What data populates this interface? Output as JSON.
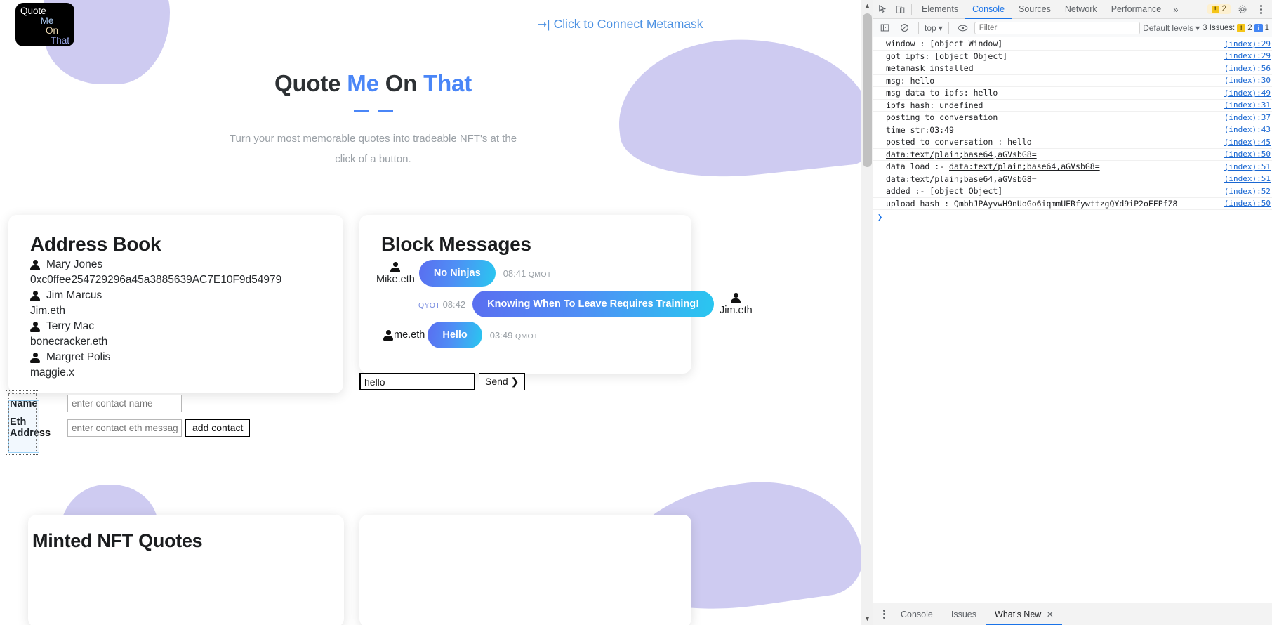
{
  "logo": {
    "line1": "Quote",
    "line2": "Me",
    "line3": "On",
    "line4": "That"
  },
  "header": {
    "connect_label": "Click to Connect Metamask",
    "connect_icon": "login-arrow-icon"
  },
  "hero": {
    "title_part1": "Quote ",
    "title_accent1": "Me",
    "title_part2": " On ",
    "title_accent2": "That",
    "subtitle": "Turn your most memorable quotes into tradeable NFT's at the click of a button."
  },
  "address_book": {
    "title": "Address Book",
    "contacts": [
      {
        "name": "Mary Jones",
        "address": "0xc0ffee254729296a45a3885639AC7E10F9d54979"
      },
      {
        "name": "Jim Marcus",
        "address": "Jim.eth"
      },
      {
        "name": "Terry Mac",
        "address": "bonecracker.eth"
      },
      {
        "name": "Margret Polis",
        "address": "maggie.x"
      }
    ]
  },
  "messages": {
    "title": "Block Messages",
    "items": [
      {
        "who": "Mike.eth",
        "text": "No Ninjas",
        "time": "08:41",
        "tag": "QMOT",
        "side": "left",
        "stamp_pos": "after"
      },
      {
        "who": "Jim.eth",
        "text": "Knowing When To Leave Requires Training!",
        "time": "08:42",
        "tag": "QYOT",
        "side": "right",
        "stamp_pos": "before"
      },
      {
        "who": "me.eth",
        "text": "Hello",
        "time": "03:49",
        "tag": "QMOT",
        "side": "left",
        "stamp_pos": "after"
      }
    ],
    "input_value": "hello",
    "send_label": "Send ❯"
  },
  "contact_form": {
    "name_label": "Name",
    "name_placeholder": "enter contact name",
    "eth_label": "Eth Address",
    "eth_placeholder": "enter contact eth message",
    "add_label": "add contact"
  },
  "nft_section": {
    "title": "Minted NFT Quotes"
  },
  "colors": {
    "accent_blue": "#4a86f7",
    "bubble_from": "#5a6ef0",
    "bubble_to": "#29c7f0",
    "blob_purple": "#c5c2ef",
    "devtools_link": "#1967d2"
  },
  "devtools": {
    "icons": {
      "inspect": "inspect-element-icon",
      "device": "device-toolbar-icon"
    },
    "tabs": [
      {
        "label": "Elements",
        "active": false
      },
      {
        "label": "Console",
        "active": true
      },
      {
        "label": "Sources",
        "active": false
      },
      {
        "label": "Network",
        "active": false
      },
      {
        "label": "Performance",
        "active": false
      }
    ],
    "more_label": "»",
    "warn_count": "2",
    "settings_icon": "gear-icon",
    "menu_icon": "kebab-menu-icon",
    "toolbar2": {
      "sidebar_icon": "console-sidebar-icon",
      "clear_icon": "clear-console-icon",
      "context": "top",
      "eye_icon": "live-expression-icon",
      "filter_placeholder": "Filter",
      "levels": "Default levels",
      "issues_label": "3 Issues:",
      "issues_warn": "2",
      "issues_info": "1"
    },
    "logs": [
      {
        "text": "window : [object Window]",
        "src": "(index):29",
        "link": false
      },
      {
        "text": "got ipfs: [object Object]",
        "src": "(index):29",
        "link": false
      },
      {
        "text": "metamask installed",
        "src": "(index):56",
        "link": false
      },
      {
        "text": "msg: hello",
        "src": "(index):30",
        "link": false
      },
      {
        "text": "msg data to ipfs: hello",
        "src": "(index):49",
        "link": false
      },
      {
        "text": "ipfs hash: undefined",
        "src": "(index):31",
        "link": false
      },
      {
        "text": " posting to conversation",
        "src": "(index):37",
        "link": false
      },
      {
        "text": "time str:03:49",
        "src": "(index):43",
        "link": false
      },
      {
        "text": "posted to conversation : hello",
        "src": "(index):45",
        "link": false
      },
      {
        "text": "data:text/plain;base64,aGVsbG8=",
        "src": "(index):50",
        "link": true
      },
      {
        "text": "data load :- data:text/plain;base64,aGVsbG8=",
        "src": "(index):51",
        "link": true
      },
      {
        "text": "data:text/plain;base64,aGVsbG8=",
        "src": "(index):51",
        "link": true
      },
      {
        "text": "added :- [object Object]",
        "src": "(index):52",
        "link": false
      },
      {
        "text": "upload hash : QmbhJPAyvwH9nUoGo6iqmmUERfywttzgQYd9iP2oEFPfZ8",
        "src": "(index):50",
        "link": false
      }
    ],
    "prompt": "❯",
    "bottom_tabs": [
      {
        "label": "Console",
        "active": false
      },
      {
        "label": "Issues",
        "active": false
      },
      {
        "label": "What's New",
        "active": true
      }
    ]
  },
  "page_scrollbar": {
    "up": "▲",
    "down": "▼"
  }
}
